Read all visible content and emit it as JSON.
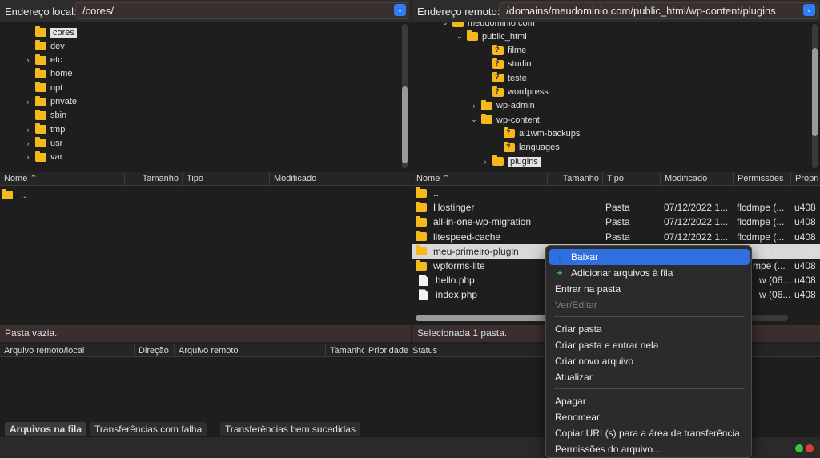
{
  "local": {
    "address_label": "Endereço local:",
    "address_value": "/cores/",
    "tree": [
      {
        "label": "cores",
        "chevron": "",
        "selected": true
      },
      {
        "label": "dev",
        "chevron": ""
      },
      {
        "label": "etc",
        "chevron": "›"
      },
      {
        "label": "home",
        "chevron": ""
      },
      {
        "label": "opt",
        "chevron": ""
      },
      {
        "label": "private",
        "chevron": "›"
      },
      {
        "label": "sbin",
        "chevron": ""
      },
      {
        "label": "tmp",
        "chevron": "›"
      },
      {
        "label": "usr",
        "chevron": "›"
      },
      {
        "label": "var",
        "chevron": "›"
      }
    ],
    "columns": {
      "name": "Nome",
      "size": "Tamanho",
      "type": "Tipo",
      "modified": "Modificado"
    },
    "files": [
      {
        "name": ".."
      }
    ],
    "status": "Pasta vazia."
  },
  "remote": {
    "address_label": "Endereço remoto:",
    "address_value": "/domains/meudominio.com/public_html/wp-content/plugins",
    "tree": [
      {
        "label": "meudominio.com",
        "chevron": "⌄",
        "q": false
      },
      {
        "label": "public_html",
        "chevron": "⌄",
        "q": false
      },
      {
        "label": "filme",
        "chevron": "",
        "q": true
      },
      {
        "label": "studio",
        "chevron": "",
        "q": true
      },
      {
        "label": "teste",
        "chevron": "",
        "q": true
      },
      {
        "label": "wordpress",
        "chevron": "",
        "q": true
      },
      {
        "label": "wp-admin",
        "chevron": "›",
        "q": false
      },
      {
        "label": "wp-content",
        "chevron": "⌄",
        "q": false
      },
      {
        "label": "ai1wm-backups",
        "chevron": "",
        "q": true
      },
      {
        "label": "languages",
        "chevron": "",
        "q": true
      },
      {
        "label": "plugins",
        "chevron": "›",
        "q": false,
        "selected": true
      }
    ],
    "columns": {
      "name": "Nome",
      "size": "Tamanho",
      "type": "Tipo",
      "modified": "Modificado",
      "permissions": "Permissões",
      "owner": "Propri"
    },
    "files": [
      {
        "name": "..",
        "kind": "folder",
        "type": "",
        "modified": "",
        "permissions": "",
        "owner": ""
      },
      {
        "name": "Hostinger",
        "kind": "folder",
        "type": "Pasta",
        "modified": "07/12/2022 1...",
        "permissions": "flcdmpe (...",
        "owner": "u408"
      },
      {
        "name": "all-in-one-wp-migration",
        "kind": "folder",
        "type": "Pasta",
        "modified": "07/12/2022 1...",
        "permissions": "flcdmpe (...",
        "owner": "u408"
      },
      {
        "name": "litespeed-cache",
        "kind": "folder",
        "type": "Pasta",
        "modified": "07/12/2022 1...",
        "permissions": "flcdmpe (...",
        "owner": "u408"
      },
      {
        "name": "meu-primeiro-plugin",
        "kind": "folder",
        "type": "",
        "modified": "",
        "permissions": "mpe (...",
        "owner": "u408",
        "selected": true
      },
      {
        "name": "wpforms-lite",
        "kind": "folder",
        "type": "",
        "modified": "",
        "permissions": "mpe (...",
        "owner": "u408"
      },
      {
        "name": "hello.php",
        "kind": "file",
        "type": "",
        "modified": "",
        "permissions": "w (06...",
        "owner": "u408"
      },
      {
        "name": "index.php",
        "kind": "file",
        "type": "",
        "modified": "",
        "permissions": "w (06...",
        "owner": "u408"
      }
    ],
    "status": "Selecionada 1 pasta."
  },
  "queue": {
    "columns": {
      "local": "Arquivo remoto/local",
      "direction": "Direção",
      "remote": "Arquivo remoto",
      "size": "Tamanho",
      "priority": "Prioridade",
      "status": "Status"
    }
  },
  "tabs": [
    {
      "label": "Arquivos na fila",
      "active": true
    },
    {
      "label": "Transferências com falha"
    },
    {
      "label": "Transferências bem sucedidas"
    }
  ],
  "context_menu": {
    "items": [
      {
        "label": "Baixar",
        "icon": "download-icon",
        "active": true
      },
      {
        "label": "Adicionar arquivos à fila",
        "icon": "add-to-queue-icon"
      },
      {
        "label": "Entrar na pasta"
      },
      {
        "label": "Ver/Editar",
        "disabled": true
      },
      {
        "sep": true
      },
      {
        "label": "Criar pasta"
      },
      {
        "label": "Criar pasta e entrar nela"
      },
      {
        "label": "Criar novo arquivo"
      },
      {
        "label": "Atualizar"
      },
      {
        "sep": true
      },
      {
        "label": "Apagar"
      },
      {
        "label": "Renomear"
      },
      {
        "label": "Copiar URL(s) para a área de transferência"
      },
      {
        "label": "Permissões do arquivo..."
      }
    ]
  },
  "colors": {
    "accent": "#2f6fe0",
    "folder": "#f6b91b",
    "status_bg": "#3a2e2e"
  }
}
